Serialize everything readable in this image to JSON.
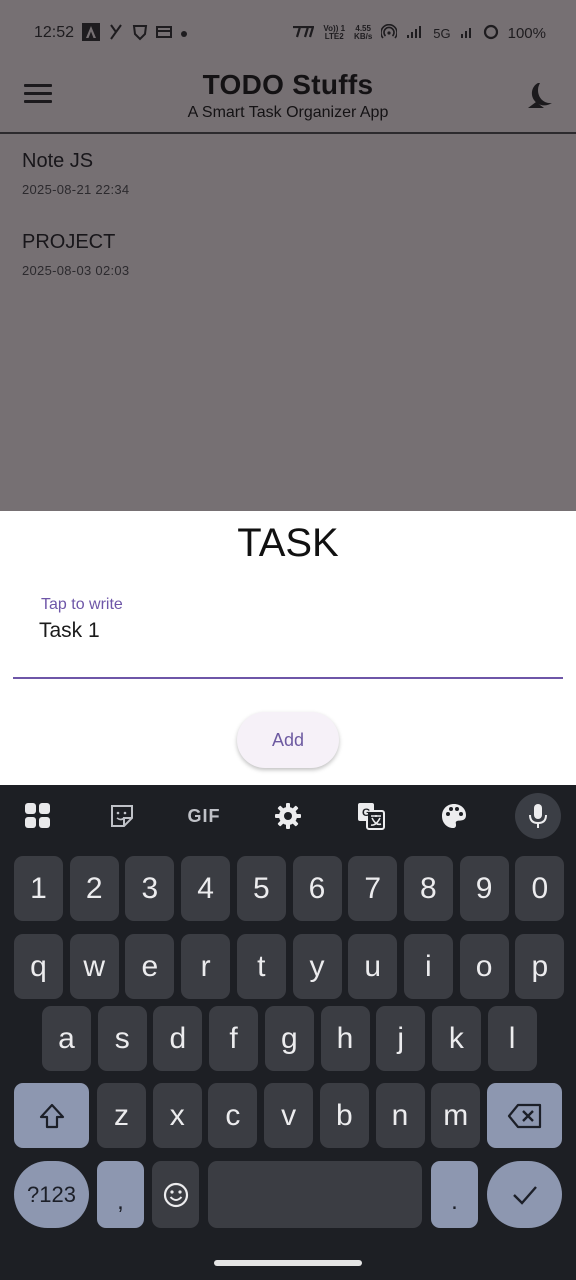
{
  "status_bar": {
    "time": "12:52",
    "net_speed_top": "4.55",
    "net_speed_unit": "KB/s",
    "volte_top": "Vo)) 1",
    "volte_bottom": "LTE2",
    "network": "5G",
    "battery": "100%"
  },
  "app_bar": {
    "title": "TODO Stuffs",
    "subtitle": "A Smart Task Organizer App"
  },
  "notes": [
    {
      "title": "Note JS",
      "date": "2025-08-21 22:34"
    },
    {
      "title": "PROJECT",
      "date": "2025-08-03 02:03"
    }
  ],
  "sheet": {
    "title": "TASK",
    "field_label": "Tap to write",
    "field_value": "Task 1",
    "add_label": "Add"
  },
  "keyboard": {
    "toolbar": [
      "apps-icon",
      "sticker-icon",
      "GIF",
      "settings-icon",
      "translate-icon",
      "palette-icon",
      "mic-icon"
    ],
    "gif_label": "GIF",
    "row_numbers": [
      "1",
      "2",
      "3",
      "4",
      "5",
      "6",
      "7",
      "8",
      "9",
      "0"
    ],
    "row_1": [
      "q",
      "w",
      "e",
      "r",
      "t",
      "y",
      "u",
      "i",
      "o",
      "p"
    ],
    "row_2": [
      "a",
      "s",
      "d",
      "f",
      "g",
      "h",
      "j",
      "k",
      "l"
    ],
    "row_3": [
      "z",
      "x",
      "c",
      "v",
      "b",
      "n",
      "m"
    ],
    "symbols_label": "?123",
    "comma": ",",
    "period": "."
  },
  "colors": {
    "accent": "#6e56a8",
    "scrim": "#767073",
    "keyboard_bg": "#1d1f24",
    "key_bg": "#3b3d43",
    "special_key_bg": "#8d97b0"
  }
}
